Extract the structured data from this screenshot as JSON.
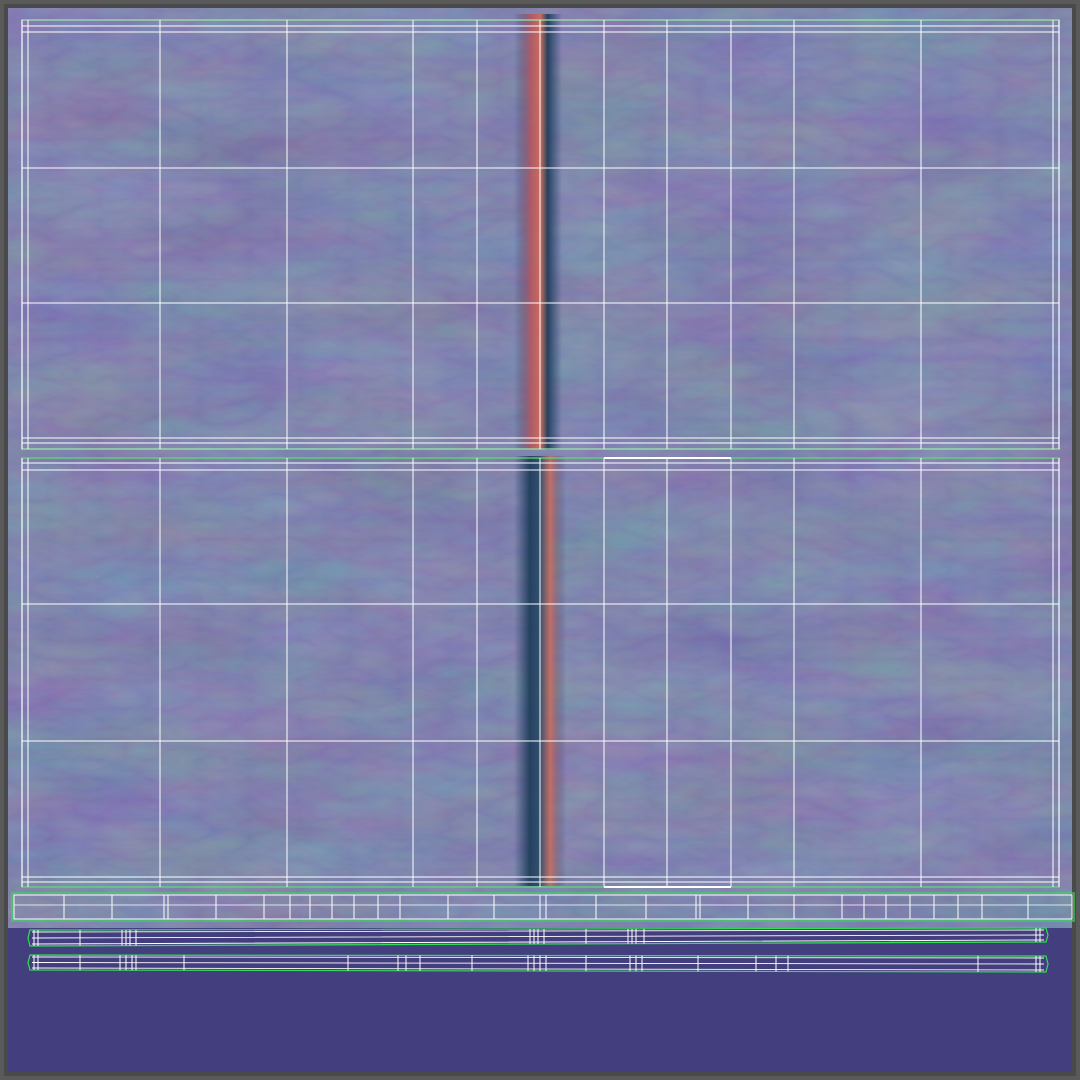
{
  "window": {
    "view": "uv-layout-normal-map"
  },
  "texture": {
    "base_color": "#433e7e",
    "map_colors": [
      "#3f3b86",
      "#4b3a86",
      "#3b5a88",
      "#3d6f7f",
      "#6b3f7a",
      "#7a4a6a"
    ],
    "seam_colors": [
      "#b5535c",
      "#d26a55",
      "#2a4a6a",
      "#1f3e5a"
    ]
  },
  "uv": {
    "wire_color": "#ffffff",
    "edge_color": "#33dd55",
    "icons": {
      "frame": "frame-icon"
    }
  }
}
